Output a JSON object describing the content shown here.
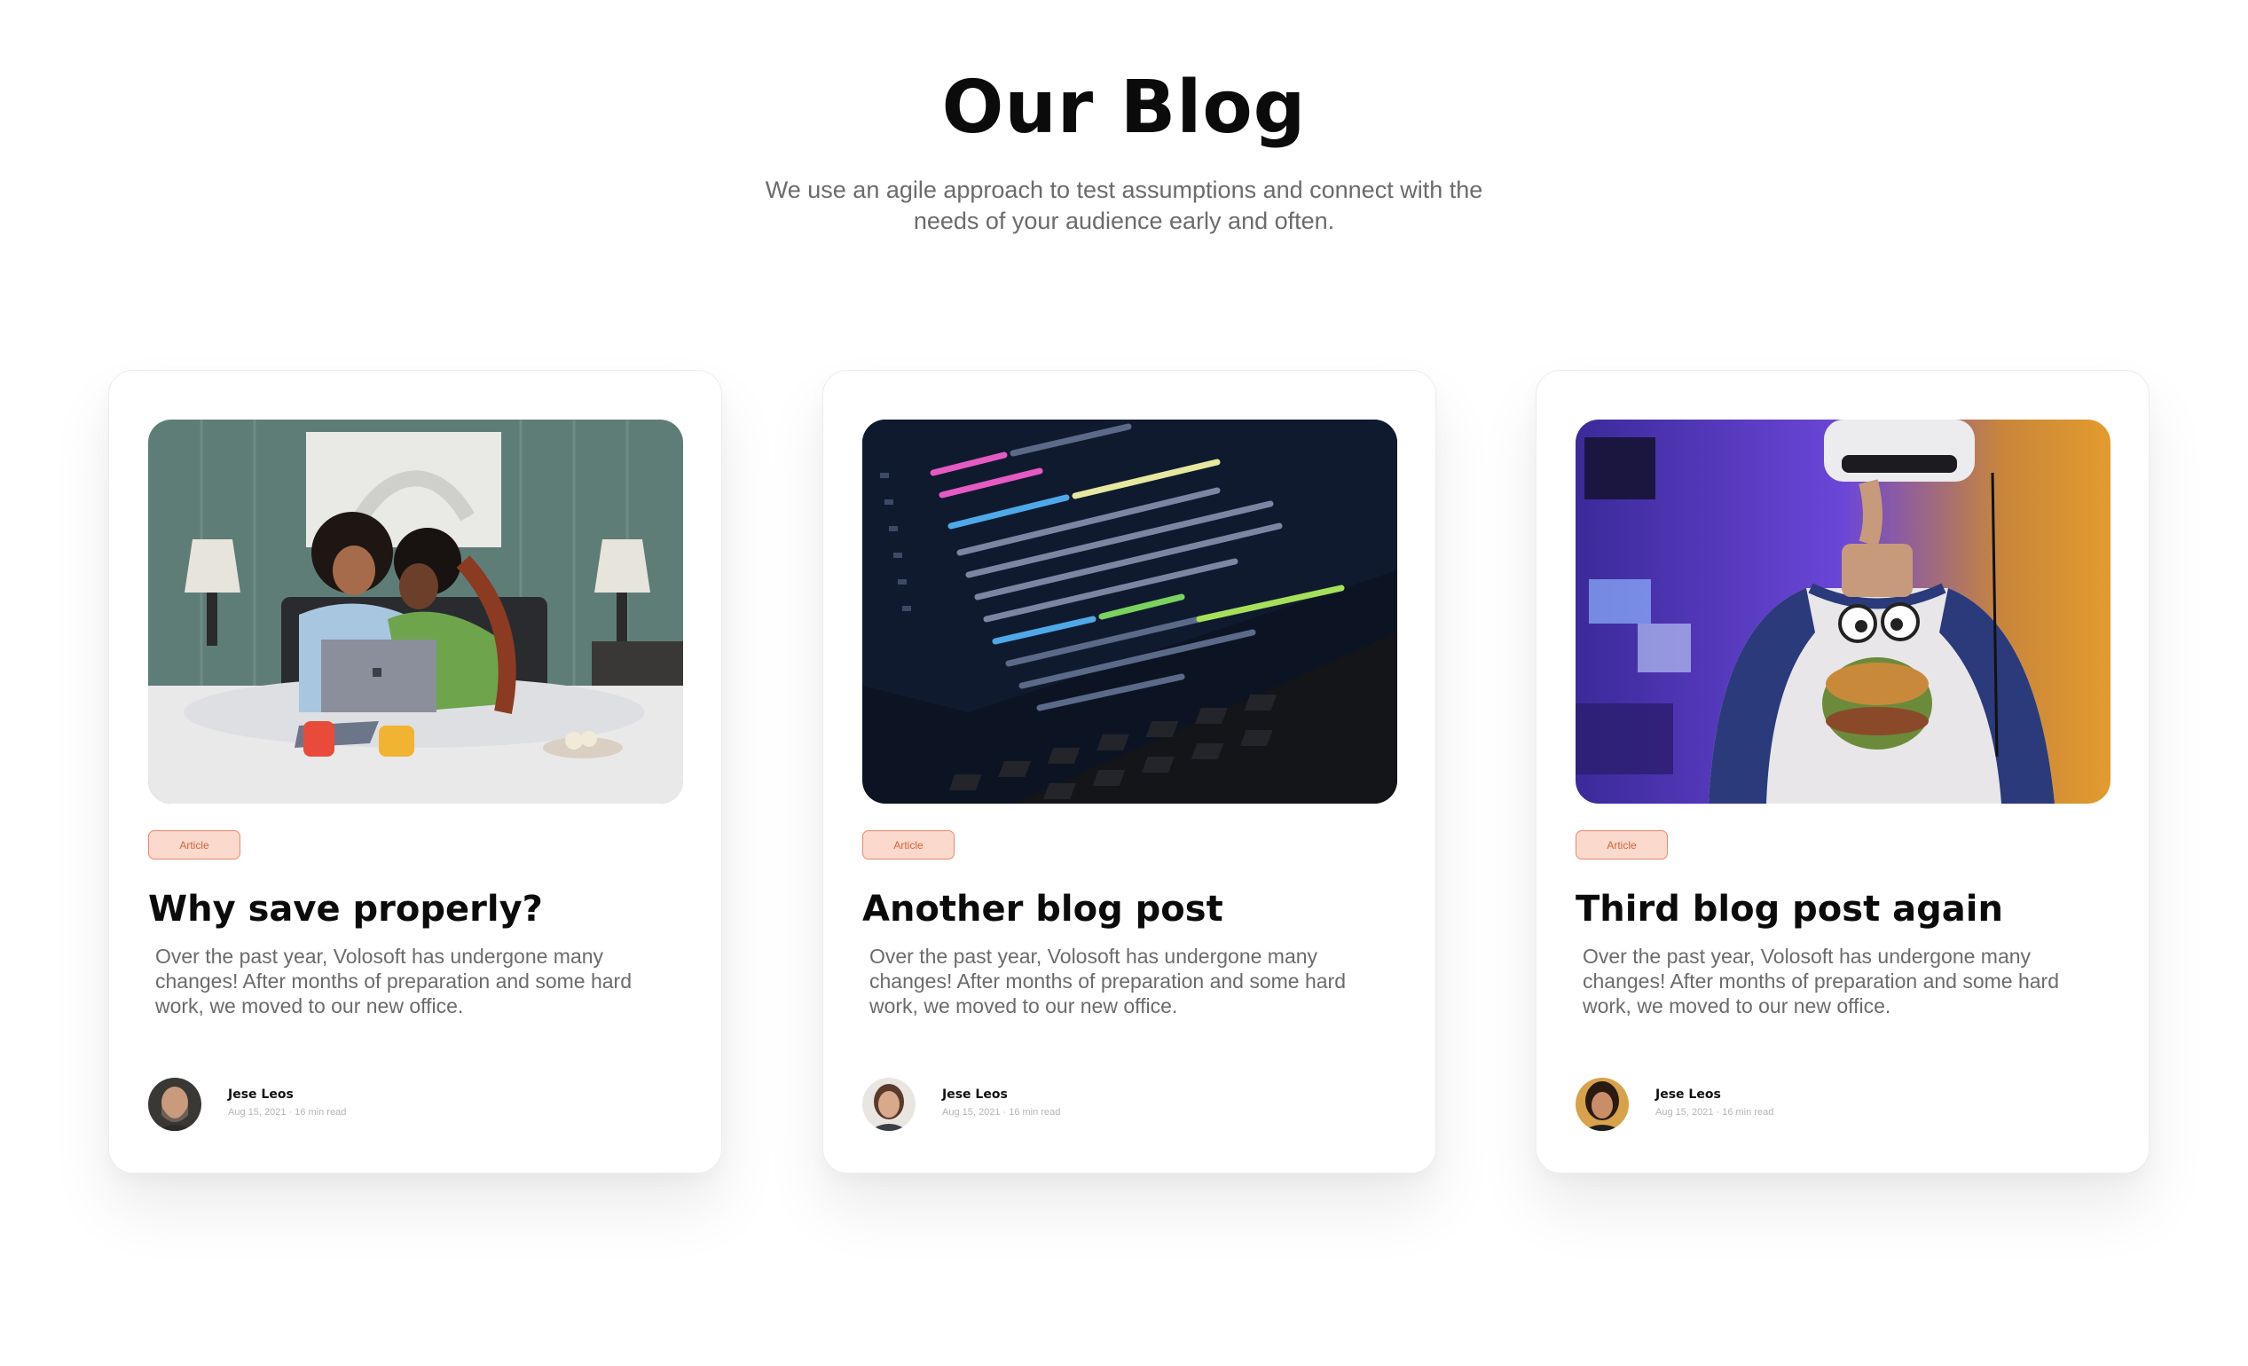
{
  "header": {
    "title": "Our Blog",
    "subtitle": "We use an agile approach to test assumptions and connect with the needs of your audience early and often."
  },
  "posts": [
    {
      "image": "photo-two-women-laptop-bed",
      "tag": "Article",
      "title": "Why save properly?",
      "excerpt": "Over the past year, Volosoft has undergone many changes! After months of preparation and some hard work, we moved to our new office.",
      "author": "Jese Leos",
      "meta": "Aug 15, 2021 · 16 min read"
    },
    {
      "image": "photo-code-on-laptop-screen",
      "tag": "Article",
      "title": "Another blog post",
      "excerpt": "Over the past year, Volosoft has undergone many changes! After months of preparation and some hard work, we moved to our new office.",
      "author": "Jese Leos",
      "meta": "Aug 15, 2021 · 16 min read"
    },
    {
      "image": "photo-person-vr-headset",
      "tag": "Article",
      "title": "Third blog post again",
      "excerpt": "Over the past year, Volosoft has undergone many changes! After months of preparation and some hard work, we moved to our new office.",
      "author": "Jese Leos",
      "meta": "Aug 15, 2021 · 16 min read"
    }
  ],
  "colors": {
    "tag_bg": "#fbd9cc",
    "tag_border": "#e58b6e",
    "tag_text": "#d0653f",
    "muted_text": "#6b6b6b"
  }
}
